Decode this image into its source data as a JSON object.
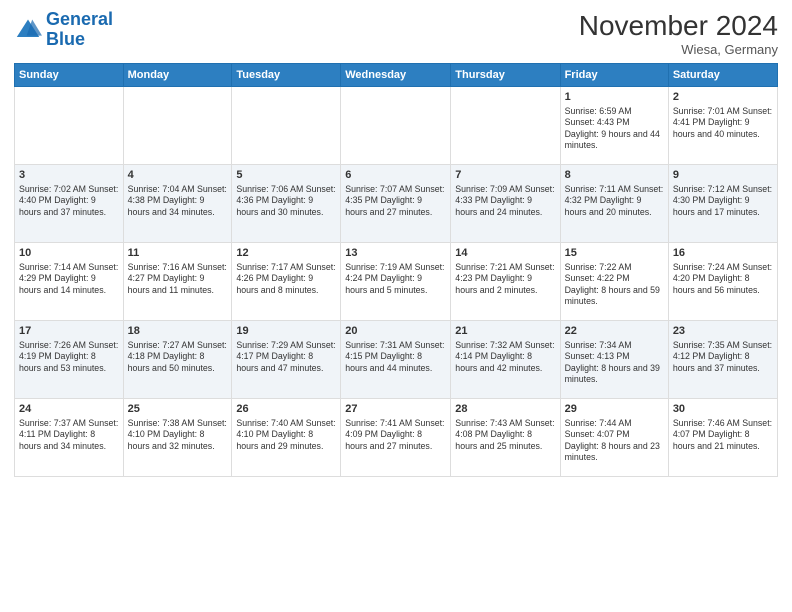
{
  "header": {
    "logo_line1": "General",
    "logo_line2": "Blue",
    "month": "November 2024",
    "location": "Wiesa, Germany"
  },
  "days_of_week": [
    "Sunday",
    "Monday",
    "Tuesday",
    "Wednesday",
    "Thursday",
    "Friday",
    "Saturday"
  ],
  "weeks": [
    [
      {
        "day": "",
        "info": ""
      },
      {
        "day": "",
        "info": ""
      },
      {
        "day": "",
        "info": ""
      },
      {
        "day": "",
        "info": ""
      },
      {
        "day": "",
        "info": ""
      },
      {
        "day": "1",
        "info": "Sunrise: 6:59 AM\nSunset: 4:43 PM\nDaylight: 9 hours and 44 minutes."
      },
      {
        "day": "2",
        "info": "Sunrise: 7:01 AM\nSunset: 4:41 PM\nDaylight: 9 hours and 40 minutes."
      }
    ],
    [
      {
        "day": "3",
        "info": "Sunrise: 7:02 AM\nSunset: 4:40 PM\nDaylight: 9 hours and 37 minutes."
      },
      {
        "day": "4",
        "info": "Sunrise: 7:04 AM\nSunset: 4:38 PM\nDaylight: 9 hours and 34 minutes."
      },
      {
        "day": "5",
        "info": "Sunrise: 7:06 AM\nSunset: 4:36 PM\nDaylight: 9 hours and 30 minutes."
      },
      {
        "day": "6",
        "info": "Sunrise: 7:07 AM\nSunset: 4:35 PM\nDaylight: 9 hours and 27 minutes."
      },
      {
        "day": "7",
        "info": "Sunrise: 7:09 AM\nSunset: 4:33 PM\nDaylight: 9 hours and 24 minutes."
      },
      {
        "day": "8",
        "info": "Sunrise: 7:11 AM\nSunset: 4:32 PM\nDaylight: 9 hours and 20 minutes."
      },
      {
        "day": "9",
        "info": "Sunrise: 7:12 AM\nSunset: 4:30 PM\nDaylight: 9 hours and 17 minutes."
      }
    ],
    [
      {
        "day": "10",
        "info": "Sunrise: 7:14 AM\nSunset: 4:29 PM\nDaylight: 9 hours and 14 minutes."
      },
      {
        "day": "11",
        "info": "Sunrise: 7:16 AM\nSunset: 4:27 PM\nDaylight: 9 hours and 11 minutes."
      },
      {
        "day": "12",
        "info": "Sunrise: 7:17 AM\nSunset: 4:26 PM\nDaylight: 9 hours and 8 minutes."
      },
      {
        "day": "13",
        "info": "Sunrise: 7:19 AM\nSunset: 4:24 PM\nDaylight: 9 hours and 5 minutes."
      },
      {
        "day": "14",
        "info": "Sunrise: 7:21 AM\nSunset: 4:23 PM\nDaylight: 9 hours and 2 minutes."
      },
      {
        "day": "15",
        "info": "Sunrise: 7:22 AM\nSunset: 4:22 PM\nDaylight: 8 hours and 59 minutes."
      },
      {
        "day": "16",
        "info": "Sunrise: 7:24 AM\nSunset: 4:20 PM\nDaylight: 8 hours and 56 minutes."
      }
    ],
    [
      {
        "day": "17",
        "info": "Sunrise: 7:26 AM\nSunset: 4:19 PM\nDaylight: 8 hours and 53 minutes."
      },
      {
        "day": "18",
        "info": "Sunrise: 7:27 AM\nSunset: 4:18 PM\nDaylight: 8 hours and 50 minutes."
      },
      {
        "day": "19",
        "info": "Sunrise: 7:29 AM\nSunset: 4:17 PM\nDaylight: 8 hours and 47 minutes."
      },
      {
        "day": "20",
        "info": "Sunrise: 7:31 AM\nSunset: 4:15 PM\nDaylight: 8 hours and 44 minutes."
      },
      {
        "day": "21",
        "info": "Sunrise: 7:32 AM\nSunset: 4:14 PM\nDaylight: 8 hours and 42 minutes."
      },
      {
        "day": "22",
        "info": "Sunrise: 7:34 AM\nSunset: 4:13 PM\nDaylight: 8 hours and 39 minutes."
      },
      {
        "day": "23",
        "info": "Sunrise: 7:35 AM\nSunset: 4:12 PM\nDaylight: 8 hours and 37 minutes."
      }
    ],
    [
      {
        "day": "24",
        "info": "Sunrise: 7:37 AM\nSunset: 4:11 PM\nDaylight: 8 hours and 34 minutes."
      },
      {
        "day": "25",
        "info": "Sunrise: 7:38 AM\nSunset: 4:10 PM\nDaylight: 8 hours and 32 minutes."
      },
      {
        "day": "26",
        "info": "Sunrise: 7:40 AM\nSunset: 4:10 PM\nDaylight: 8 hours and 29 minutes."
      },
      {
        "day": "27",
        "info": "Sunrise: 7:41 AM\nSunset: 4:09 PM\nDaylight: 8 hours and 27 minutes."
      },
      {
        "day": "28",
        "info": "Sunrise: 7:43 AM\nSunset: 4:08 PM\nDaylight: 8 hours and 25 minutes."
      },
      {
        "day": "29",
        "info": "Sunrise: 7:44 AM\nSunset: 4:07 PM\nDaylight: 8 hours and 23 minutes."
      },
      {
        "day": "30",
        "info": "Sunrise: 7:46 AM\nSunset: 4:07 PM\nDaylight: 8 hours and 21 minutes."
      }
    ]
  ]
}
